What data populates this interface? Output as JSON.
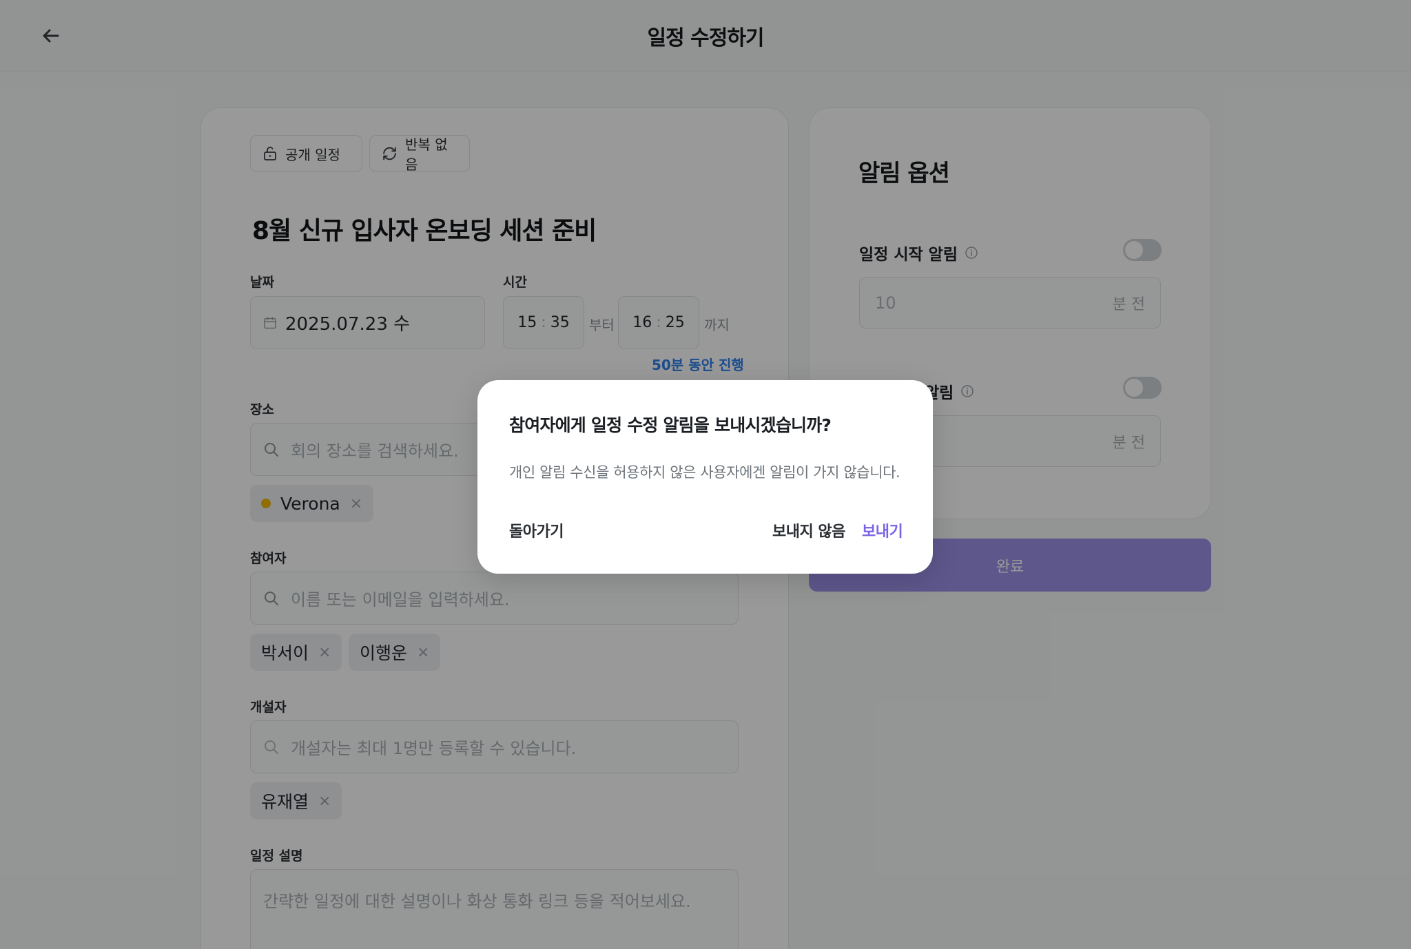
{
  "header": {
    "title": "일정 수정하기"
  },
  "form": {
    "visibility_label": "공개 일정",
    "repeat_label": "반복 없음",
    "event_title": "8월 신규 입사자 온보딩 세션 준비",
    "date_label": "날짜",
    "date_value": "2025.07.23 수",
    "time_label": "시간",
    "start_hour": "15",
    "start_minute": "35",
    "start_suffix": "부터",
    "end_hour": "16",
    "end_minute": "25",
    "end_suffix": "까지",
    "duration": "50분 동안 진행",
    "time_sep": ":",
    "location_label": "장소",
    "location_placeholder": "회의 장소를 검색하세요.",
    "location_tags": [
      "Verona"
    ],
    "participants_label": "참여자",
    "participants_placeholder": "이름 또는 이메일을 입력하세요.",
    "participants": [
      "박서이",
      "이행운"
    ],
    "creator_label": "개설자",
    "creator_placeholder": "개설자는 최대 1명만 등록할 수 있습니다.",
    "creators": [
      "유재열"
    ],
    "description_label": "일정 설명",
    "description_placeholder": "간략한 일정에 대한 설명이나 화상 통화 링크 등을 적어보세요.",
    "remove_symbol": "×"
  },
  "alarm": {
    "title": "알림 옵션",
    "start_alarm_label": "일정 시작 알림",
    "start_alarm_value": "10",
    "unit": "분 전",
    "second_alarm_label": "알림",
    "second_alarm_value": "",
    "done_label": "완료"
  },
  "modal": {
    "title": "참여자에게 일정 수정 알림을 보내시겠습니까?",
    "description": "개인 알림 수신을 허용하지 않은 사용자에겐 알림이 가지 않습니다.",
    "back_label": "돌아가기",
    "no_send_label": "보내지 않음",
    "send_label": "보내기"
  },
  "colors": {
    "accent": "#7b63e6",
    "link": "#2f80ed",
    "location_dot": "#f2b705"
  }
}
